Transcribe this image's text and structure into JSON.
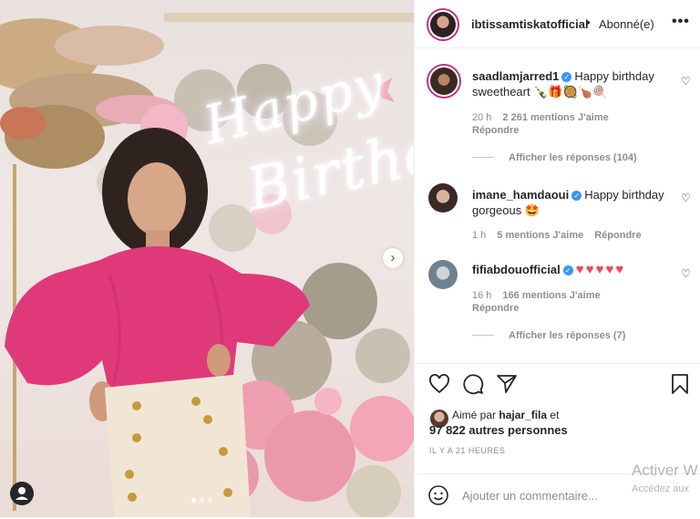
{
  "post": {
    "author": "ibtissamtiskatofficial",
    "separator": "•",
    "follow_status": "Abonné(e)",
    "more_icon": "more-options-icon"
  },
  "photo": {
    "neon_line1": "Happy",
    "neon_line2": "Birthd",
    "next_icon": "chevron-right-icon",
    "tag_icon": "user-tag-icon"
  },
  "comments": [
    {
      "username": "saadlamjarred1",
      "verified": true,
      "text": "Happy birthday sweetheart 🍾🎁🥘🍗🍭",
      "time": "20 h",
      "likes": "2 261 mentions J'aime",
      "reply": "Répondre",
      "view_replies": "Afficher les réponses (104)"
    },
    {
      "username": "imane_hamdaoui",
      "verified": true,
      "text": "Happy birthday gorgeous 🤩",
      "time": "1 h",
      "likes": "5 mentions J'aime",
      "reply": "Répondre"
    },
    {
      "username": "fifiabdouofficial",
      "verified": true,
      "text": "♥♥♥♥♥",
      "time": "16 h",
      "likes": "166 mentions J'aime",
      "reply": "Répondre",
      "view_replies": "Afficher les réponses (7)"
    }
  ],
  "actions": {
    "like_icon": "heart-icon",
    "comment_icon": "comment-icon",
    "share_icon": "share-icon",
    "save_icon": "bookmark-icon"
  },
  "likes_summary": {
    "prefix": "Aimé par",
    "user": "hajar_fila",
    "suffix": "et",
    "count": "97 822 autres personnes"
  },
  "timestamp": "IL Y A 21 HEURES",
  "add_comment": {
    "placeholder": "Ajouter un commentaire...",
    "emoji_icon": "emoji-icon"
  },
  "watermark": {
    "line1": "Activer W",
    "line2": "Accédez aux"
  },
  "colors": {
    "verified": "#3897f0",
    "heart_red": "#ed4956",
    "meta_gray": "#8e8e8e"
  }
}
